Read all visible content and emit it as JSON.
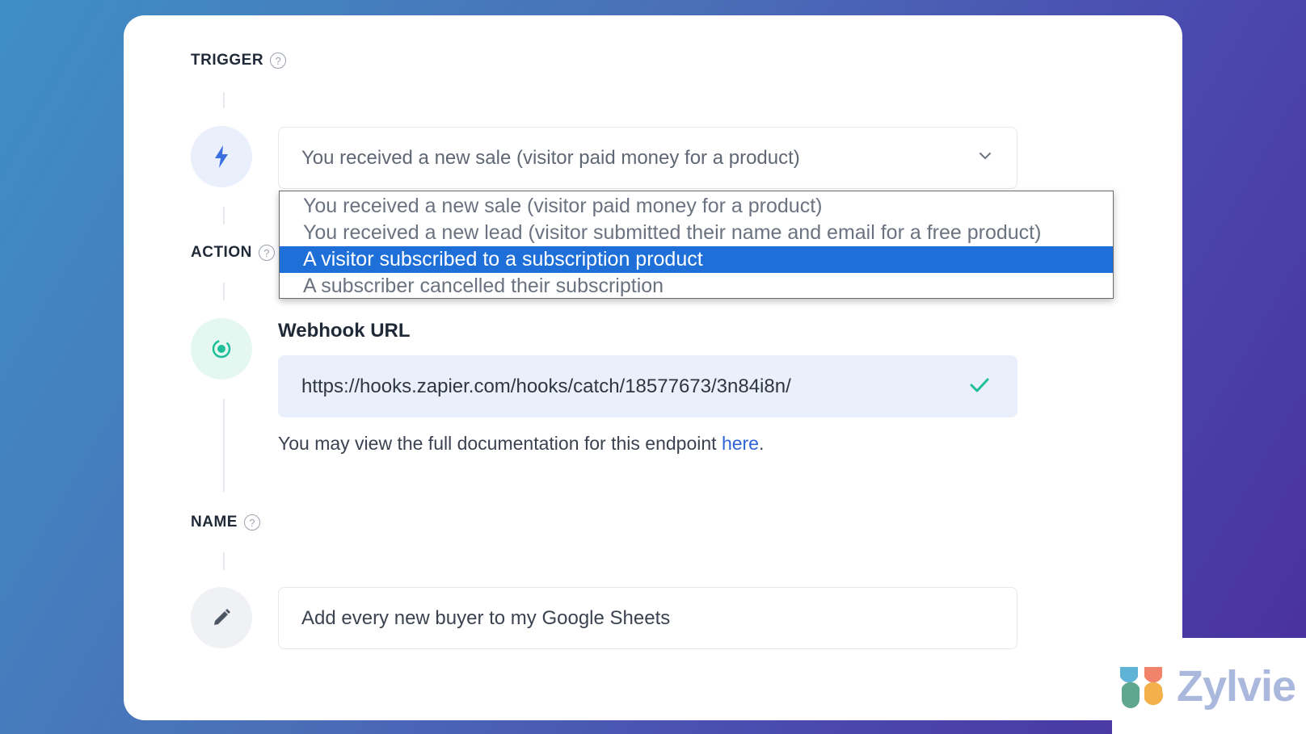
{
  "trigger": {
    "label": "TRIGGER",
    "selected": "You received a new sale (visitor paid money for a product)",
    "options": [
      "You received a new sale (visitor paid money for a product)",
      "You received a new lead (visitor submitted their name and email for a free product)",
      "A visitor subscribed to a subscription product",
      "A subscriber cancelled their subscription"
    ],
    "highlighted_option": "A visitor subscribed to a subscription product"
  },
  "action": {
    "label": "ACTION",
    "webhook_title": "Webhook URL",
    "webhook_url": "https://hooks.zapier.com/hooks/catch/18577673/3n84i8n/",
    "doc_text": "You may view the full documentation for this endpoint ",
    "doc_link": "here",
    "doc_end": "."
  },
  "name": {
    "label": "NAME",
    "value": "Add every new buyer to my Google Sheets"
  },
  "help_glyph": "?",
  "brand": {
    "name": "Zylvie"
  },
  "icons": {
    "trigger": "lightning-icon",
    "action": "webhook-icon",
    "name": "pencil-icon"
  },
  "colors": {
    "selected_option": "#1f6fd8",
    "link": "#2f64d8",
    "check": "#1fbf9a"
  }
}
